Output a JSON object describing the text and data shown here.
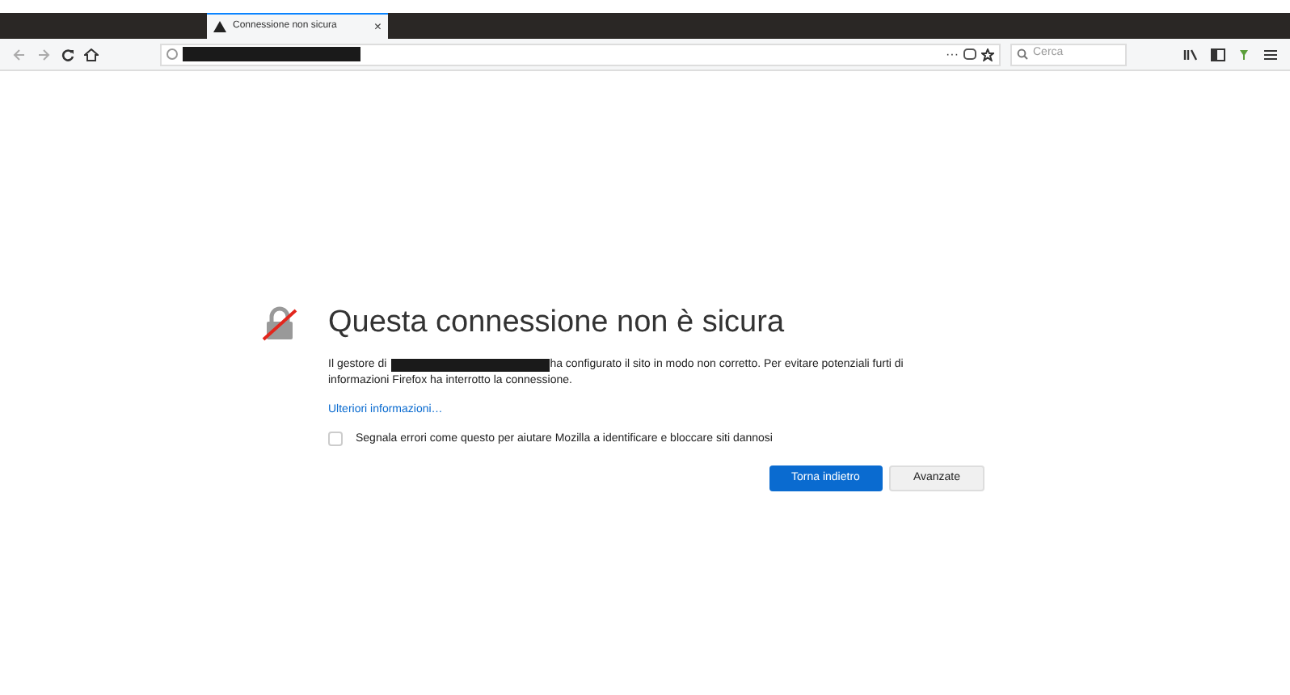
{
  "tab": {
    "title": "Connessione non sicura",
    "close": "×"
  },
  "toolbar": {
    "search": {
      "placeholder": "Cerca"
    },
    "page_actions": "···"
  },
  "error": {
    "title": "Questa connessione non è sicura",
    "text_before": "Il gestore di",
    "text_after": "ha configurato il sito in modo non corretto. Per evitare potenziali furti di",
    "text_line2": "informazioni Firefox ha interrotto la connessione.",
    "link": "Ulteriori informazioni…",
    "report": {
      "label": "Segnala errori come questo per aiutare Mozilla a identificare e bloccare siti dannosi",
      "checked": false
    },
    "buttons": [
      {
        "label": "Torna indietro",
        "kind": "primary"
      },
      {
        "label": "Avanzate",
        "kind": "secondary"
      }
    ]
  }
}
